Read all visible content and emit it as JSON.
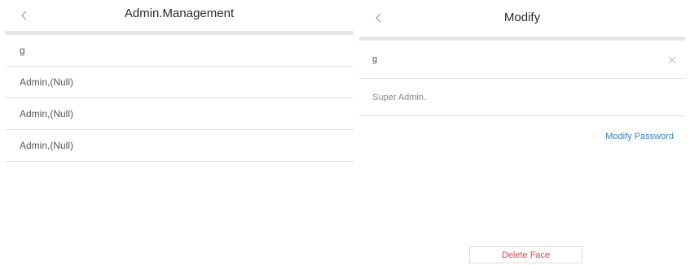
{
  "left": {
    "title": "Admin.Management",
    "items": [
      {
        "label": "g"
      },
      {
        "label": "Admin,(Null)"
      },
      {
        "label": "Admin,(Null)"
      },
      {
        "label": "Admin,(Null)"
      }
    ]
  },
  "right": {
    "title": "Modify",
    "name_value": "g",
    "role_text": "Super Admin.",
    "modify_password_label": "Modify Password",
    "delete_face_label": "Delete Face"
  },
  "icons": {
    "back": "chevron-left-icon",
    "clear": "close-icon"
  },
  "colors": {
    "divider_band": "#e6e6e6",
    "link_blue": "#3b7fc4",
    "danger_red": "#e2404c"
  }
}
